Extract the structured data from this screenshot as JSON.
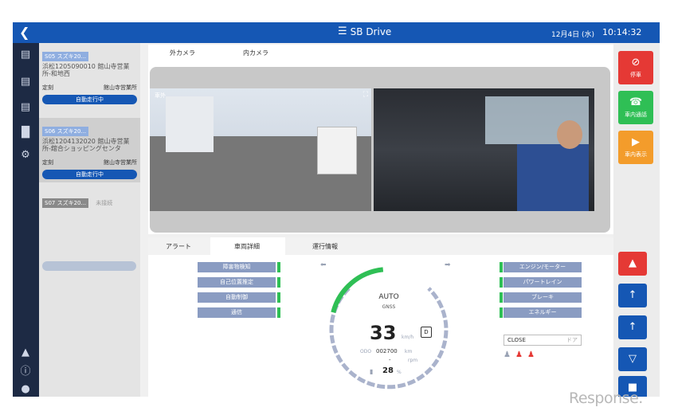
{
  "topbar": {
    "back_icon": "chevron-left-icon",
    "menu_icon": "menu-icon",
    "brand": "SB Drive",
    "date": "12月4日 (水)",
    "time": "10:14:32"
  },
  "nav": {
    "icons": [
      "map-icon",
      "document-icon",
      "report-icon",
      "chart-icon",
      "gear-icon"
    ],
    "bottom_icons": [
      "bell-icon",
      "info-icon",
      "user-icon"
    ]
  },
  "vehicles": [
    {
      "tag": "S05 スズキ20...",
      "route": "浜松1205090010 館山寺営業所-和地西",
      "left": "定刻",
      "right": "館山寺営業所",
      "status": "自動走行中"
    },
    {
      "tag": "S06 スズキ20...",
      "route": "浜松1204132020 館山寺営業所-舘合ショッピングセンタ",
      "left": "定刻",
      "right": "館山寺営業所",
      "status": "自動走行中"
    },
    {
      "tag": "S07 スズキ20...",
      "unconnected": "未接続"
    }
  ],
  "camera": {
    "tabs": [
      "外カメラ",
      "内カメラ"
    ],
    "ext_label": "車外",
    "expand_icon": "expand-icon"
  },
  "side_buttons": [
    {
      "label": "停車",
      "icon": "stop-icon",
      "color": "#e53935"
    },
    {
      "label": "車内通話",
      "icon": "phone-icon",
      "color": "#2fbf55"
    },
    {
      "label": "車内表示",
      "icon": "display-icon",
      "color": "#f39c2b"
    }
  ],
  "bottom_buttons": [
    {
      "icon": "hazard-icon",
      "color": "#e53935"
    },
    {
      "icon": "door-open-icon",
      "color": "#1557b4"
    },
    {
      "icon": "door-close-icon",
      "color": "#1557b4"
    },
    {
      "icon": "wiper-icon",
      "color": "#1557b4"
    },
    {
      "icon": "horn-icon",
      "color": "#1557b4"
    }
  ],
  "detail": {
    "tabs": [
      "アラート",
      "車両詳細",
      "運行情報"
    ],
    "sensors": [
      "障害物検知",
      "自己位置推定",
      "自動制御",
      "通信"
    ],
    "systems": [
      "エンジン/モーター",
      "パワートレイン",
      "ブレーキ",
      "エネルギー"
    ],
    "door": {
      "state": "CLOSE",
      "label": "ドア"
    },
    "gauge": {
      "mode": "AUTO",
      "source": "GNSS",
      "speed": "33",
      "speed_unit": "km/h",
      "gear": "D",
      "odo_label": "ODO",
      "odo_value": "002700",
      "odo_unit": "km",
      "rpm_value": "-",
      "rpm_unit": "rpm",
      "fuel": "28",
      "fuel_unit": "%",
      "fuel_fraction": 0.28
    },
    "passenger_icons": [
      "seat-empty-icon",
      "seat-occupied-icon",
      "seat-occupied-icon"
    ]
  },
  "watermark": "Response."
}
